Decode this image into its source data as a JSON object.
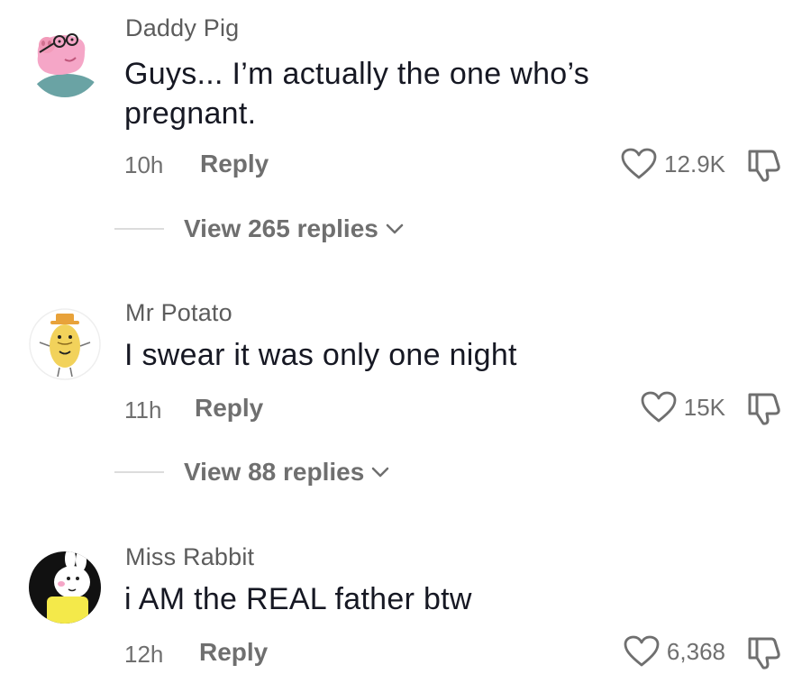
{
  "comments": [
    {
      "username": "Daddy Pig",
      "text_lines": [
        "Guys... I’m actually the one who’s",
        "pregnant."
      ],
      "time": "10h",
      "reply_label": "Reply",
      "likes": "12.9K",
      "view_replies": "View 265 replies",
      "avatar_icon": "daddy-pig-avatar"
    },
    {
      "username": "Mr Potato",
      "text_lines": [
        "I swear it was only one night"
      ],
      "time": "11h",
      "reply_label": "Reply",
      "likes": "15K",
      "view_replies": "View 88 replies",
      "avatar_icon": "mr-potato-avatar"
    },
    {
      "username": "Miss Rabbit",
      "text_lines": [
        "i AM the REAL father btw"
      ],
      "time": "12h",
      "reply_label": "Reply",
      "likes": "6,368",
      "avatar_icon": "miss-rabbit-avatar"
    }
  ],
  "colors": {
    "text": "#161823",
    "muted": "#6f6f6f",
    "username": "#5c5c5c",
    "divider": "#dcdcdc"
  }
}
